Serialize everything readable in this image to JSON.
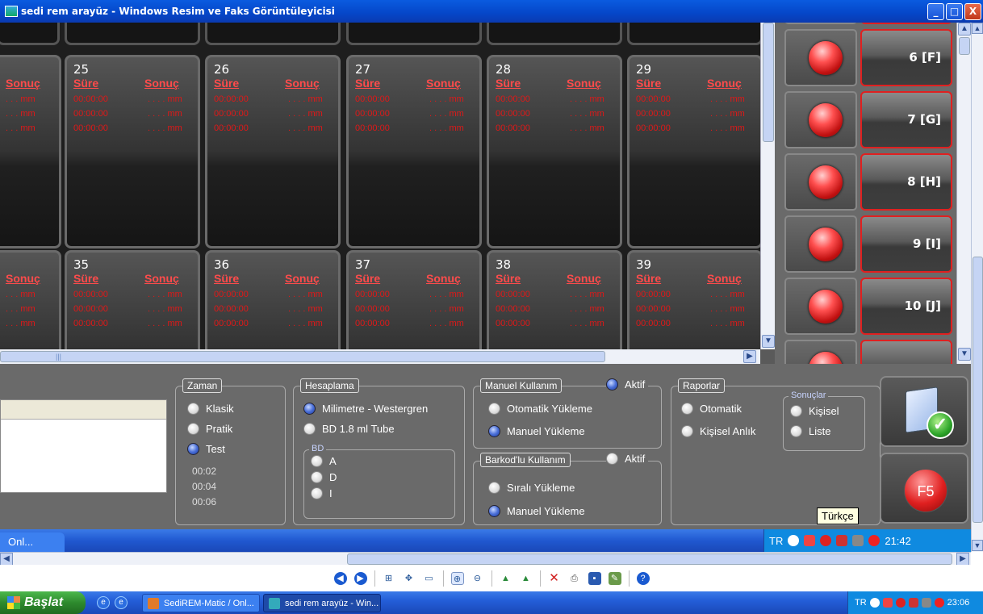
{
  "window": {
    "title": "sedi rem arayüz - Windows Resim ve Faks Görüntüleyicisi",
    "min": "_",
    "max": "□",
    "close": "X"
  },
  "grid": {
    "row1": [
      {
        "partial": true,
        "h2": "Sonuç",
        "col_b": [
          ". . . mm",
          ". . . mm",
          ". . . mm"
        ]
      },
      {
        "num": "25",
        "h1": "Süre",
        "h2": "Sonuç",
        "col_a": [
          "00:00:00",
          "00:00:00",
          "00:00:00"
        ],
        "col_b": ". . . . mm"
      },
      {
        "num": "26",
        "h1": "Süre",
        "h2": "Sonuç",
        "col_a": [
          "00:00:00",
          "00:00:00",
          "00:00:00"
        ],
        "col_b": ". . . . mm"
      },
      {
        "num": "27",
        "h1": "Süre",
        "h2": "Sonuç",
        "col_a": [
          "00:00:00",
          "00:00:00",
          "00:00:00"
        ],
        "col_b": ". . . . mm"
      },
      {
        "num": "28",
        "h1": "Süre",
        "h2": "Sonuç",
        "col_a": [
          "00:00:00",
          "00:00:00",
          "00:00:00"
        ],
        "col_b": ". . . . mm"
      },
      {
        "num": "29",
        "h1": "Süre",
        "h2": "Sonuç",
        "col_a": [
          "00:00:00",
          "00:00:00",
          "00:00:00"
        ],
        "col_b": ". . . . mm"
      }
    ],
    "row2": [
      {
        "partial": true,
        "h2": "Sonuç",
        "col_b": ". . . mm"
      },
      {
        "num": "35",
        "h1": "Süre",
        "h2": "Sonuç",
        "col_a": "00:00:00",
        "col_b": ". . . . mm"
      },
      {
        "num": "36",
        "h1": "Süre",
        "h2": "Sonuç",
        "col_a": "00:00:00",
        "col_b": ". . . . mm"
      },
      {
        "num": "37",
        "h1": "Süre",
        "h2": "Sonuç",
        "col_a": "00:00:00",
        "col_b": ". . . . mm"
      },
      {
        "num": "38",
        "h1": "Süre",
        "h2": "Sonuç",
        "col_a": "00:00:00",
        "col_b": ". . . . mm"
      },
      {
        "num": "39",
        "h1": "Süre",
        "h2": "Sonuç",
        "col_a": "00:00:00",
        "col_b": ". . . . mm"
      }
    ]
  },
  "slots": [
    "6 [F]",
    "7 [G]",
    "8 [H]",
    "9 [I]",
    "10 [J]"
  ],
  "panels": {
    "zaman": {
      "label": "Zaman",
      "options": [
        "Klasik",
        "Pratik",
        "Test"
      ],
      "times": [
        "00:02",
        "00:04",
        "00:06"
      ]
    },
    "hesaplama": {
      "label": "Hesaplama",
      "options": [
        "Milimetre - Westergren",
        "BD 1.8 ml Tube"
      ],
      "bd_label": "BD",
      "bd_options": [
        "A",
        "D",
        "I"
      ]
    },
    "manuel": {
      "label": "Manuel Kullanım",
      "aktif": "Aktif",
      "options": [
        "Otomatik Yükleme",
        "Manuel Yükleme"
      ]
    },
    "barkod": {
      "label": "Barkod'lu Kullanım",
      "aktif": "Aktif",
      "options": [
        "Sıralı Yükleme",
        "Manuel Yükleme"
      ]
    },
    "raporlar": {
      "label": "Raporlar",
      "options": [
        "Otomatik",
        "Kişisel Anlık"
      ]
    },
    "sonuclar": {
      "label": "Sonuçlar",
      "options": [
        "Kişisel",
        "Liste"
      ]
    }
  },
  "f5_label": "F5",
  "tooltip": "Türkçe",
  "inner_taskbar": {
    "segment": "Onl...",
    "lang": "TR",
    "clock": "21:42"
  },
  "colors": {
    "accent_red": "#e02020",
    "xp_blue": "#245ed8",
    "panel_gray": "#6a6a6a"
  },
  "taskbar": {
    "start": "Başlat",
    "buttons": [
      "SediREM-Matic / Onl...",
      "sedi rem arayüz - Win..."
    ],
    "lang": "TR",
    "clock": "23:06"
  }
}
